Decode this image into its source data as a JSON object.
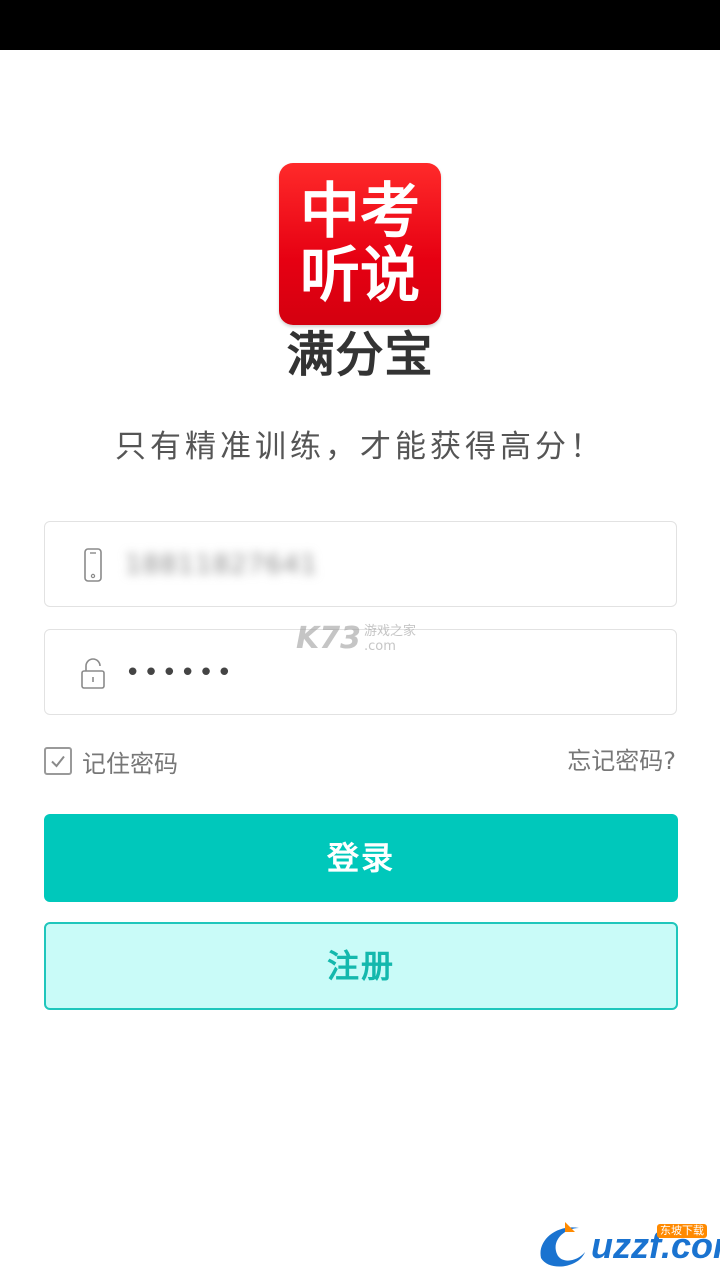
{
  "app": {
    "logo_line1": "中考",
    "logo_line2": "听说",
    "logo_subtitle": "满分宝",
    "slogan": "只有精准训练，才能获得高分！"
  },
  "login_form": {
    "phone_value": "18811827641",
    "password_mask": "••••••",
    "remember_label": "记住密码",
    "remember_checked": true,
    "forgot_label": "忘记密码?",
    "login_label": "登录",
    "register_label": "注册"
  },
  "watermark": {
    "k73_big": "K73",
    "k73_small1": "游戏之家",
    "k73_small2": ".com",
    "corner_text": "uzzf.com",
    "corner_tag": "东坡下载"
  },
  "colors": {
    "primary": "#00c8bb",
    "register_bg": "#c9fbf8",
    "logo_red": "#e60012"
  },
  "icons": {
    "phone": "phone-icon",
    "lock": "lock-icon",
    "checkbox": "check-icon"
  }
}
